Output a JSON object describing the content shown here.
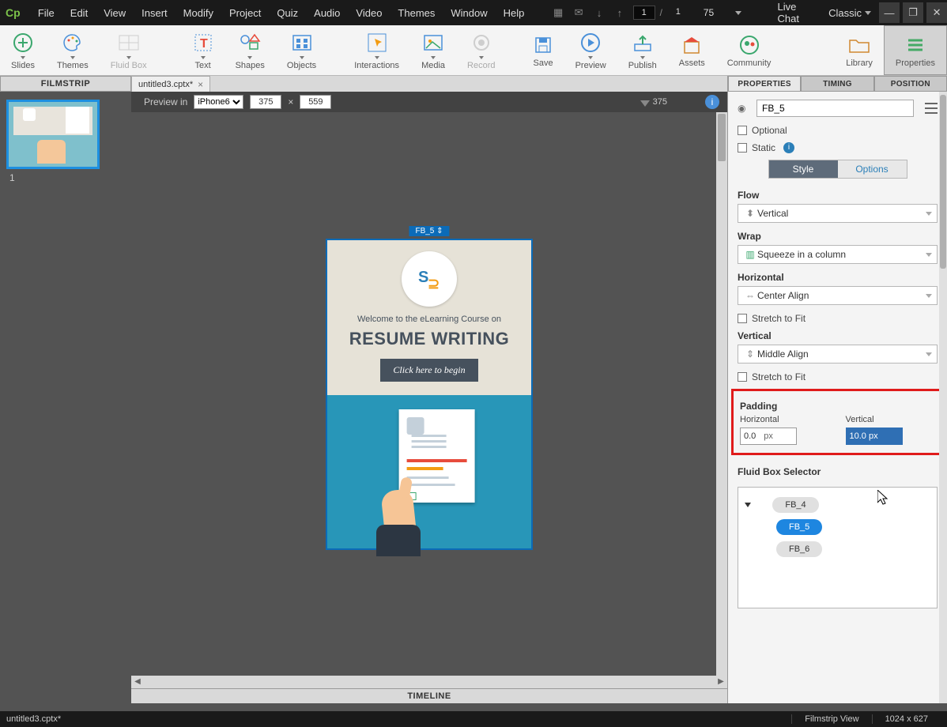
{
  "menubar": {
    "items": [
      "File",
      "Edit",
      "View",
      "Insert",
      "Modify",
      "Project",
      "Quiz",
      "Audio",
      "Video",
      "Themes",
      "Window",
      "Help"
    ],
    "page_current": "1",
    "page_total": "1",
    "zoom": "75",
    "livechat": "Live Chat",
    "workspace": "Classic"
  },
  "toolbar": {
    "items": [
      {
        "label": "Slides",
        "icon": "plus-circle"
      },
      {
        "label": "Themes",
        "icon": "palette"
      },
      {
        "label": "Fluid Box",
        "icon": "grid",
        "disabled": true
      },
      {
        "label": "Text",
        "icon": "text"
      },
      {
        "label": "Shapes",
        "icon": "shapes"
      },
      {
        "label": "Objects",
        "icon": "objects"
      },
      {
        "label": "Interactions",
        "icon": "pointer"
      },
      {
        "label": "Media",
        "icon": "image"
      },
      {
        "label": "Record",
        "icon": "record",
        "disabled": true
      },
      {
        "label": "Save",
        "icon": "save"
      },
      {
        "label": "Preview",
        "icon": "play"
      },
      {
        "label": "Publish",
        "icon": "upload"
      },
      {
        "label": "Assets",
        "icon": "box"
      },
      {
        "label": "Community",
        "icon": "people"
      },
      {
        "label": "Library",
        "icon": "folder"
      },
      {
        "label": "Properties",
        "icon": "menu",
        "active": true
      }
    ]
  },
  "filmstrip": {
    "header": "FILMSTRIP",
    "thumb_number": "1"
  },
  "doctab": {
    "label": "untitled3.cptx*"
  },
  "previewbar": {
    "label": "Preview in",
    "device": "iPhone6",
    "width": "375",
    "height": "559",
    "ruler": "375"
  },
  "slide": {
    "fb_label": "FB_5",
    "welcome": "Welcome to the eLearning Course on",
    "title": "RESUME WRITING",
    "cta": "Click here to begin"
  },
  "timeline": {
    "header": "TIMELINE"
  },
  "panel": {
    "tabs": [
      "PROPERTIES",
      "TIMING",
      "POSITION"
    ],
    "object_name": "FB_5",
    "optional_label": "Optional",
    "static_label": "Static",
    "subtabs": [
      "Style",
      "Options"
    ],
    "flow": {
      "label": "Flow",
      "value": "Vertical"
    },
    "wrap": {
      "label": "Wrap",
      "value": "Squeeze in a column"
    },
    "horizontal": {
      "label": "Horizontal",
      "value": "Center Align",
      "stretch": "Stretch to Fit"
    },
    "vertical": {
      "label": "Vertical",
      "value": "Middle Align",
      "stretch": "Stretch to Fit"
    },
    "padding": {
      "label": "Padding",
      "h_label": "Horizontal",
      "h_value": "0.0",
      "h_unit": "px",
      "v_label": "Vertical",
      "v_value": "10.0 px"
    },
    "fbselector": {
      "label": "Fluid Box Selector",
      "items": [
        "FB_4",
        "FB_5",
        "FB_6"
      ]
    }
  },
  "statusbar": {
    "file": "untitled3.cptx*",
    "view": "Filmstrip View",
    "dims": "1024 x 627"
  }
}
